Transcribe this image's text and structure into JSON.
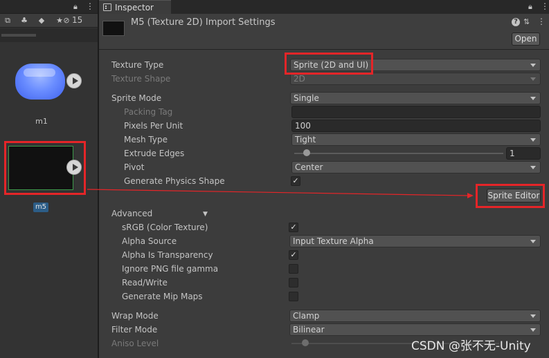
{
  "project_panel": {
    "hidden_count": "15",
    "assets": [
      {
        "name": "m1"
      },
      {
        "name": "m5"
      }
    ]
  },
  "inspector": {
    "tab_label": "Inspector",
    "title": "M5 (Texture 2D) Import Settings",
    "open_button": "Open",
    "fields": {
      "texture_type": {
        "label": "Texture Type",
        "value": "Sprite (2D and UI)"
      },
      "texture_shape": {
        "label": "Texture Shape",
        "value": "2D"
      },
      "sprite_mode": {
        "label": "Sprite Mode",
        "value": "Single"
      },
      "packing_tag": {
        "label": "Packing Tag",
        "value": ""
      },
      "pixels_per_unit": {
        "label": "Pixels Per Unit",
        "value": "100"
      },
      "mesh_type": {
        "label": "Mesh Type",
        "value": "Tight"
      },
      "extrude_edges": {
        "label": "Extrude Edges",
        "value": "1",
        "slider_fraction": 0.031
      },
      "pivot": {
        "label": "Pivot",
        "value": "Center"
      },
      "generate_physics_shape": {
        "label": "Generate Physics Shape",
        "checked": true
      }
    },
    "sprite_editor_button": "Sprite Editor",
    "advanced": {
      "label": "Advanced",
      "srgb": {
        "label": "sRGB (Color Texture)",
        "checked": true
      },
      "alpha_source": {
        "label": "Alpha Source",
        "value": "Input Texture Alpha"
      },
      "alpha_is_transparency": {
        "label": "Alpha Is Transparency",
        "checked": true
      },
      "ignore_png_gamma": {
        "label": "Ignore PNG file gamma",
        "checked": false
      },
      "read_write": {
        "label": "Read/Write",
        "checked": false
      },
      "generate_mip_maps": {
        "label": "Generate Mip Maps",
        "checked": false
      }
    },
    "wrap_mode": {
      "label": "Wrap Mode",
      "value": "Clamp"
    },
    "filter_mode": {
      "label": "Filter Mode",
      "value": "Bilinear"
    },
    "aniso_level": {
      "label": "Aniso Level"
    }
  },
  "watermark": "CSDN @张不无-Unity",
  "annotation_color": "#e52528"
}
